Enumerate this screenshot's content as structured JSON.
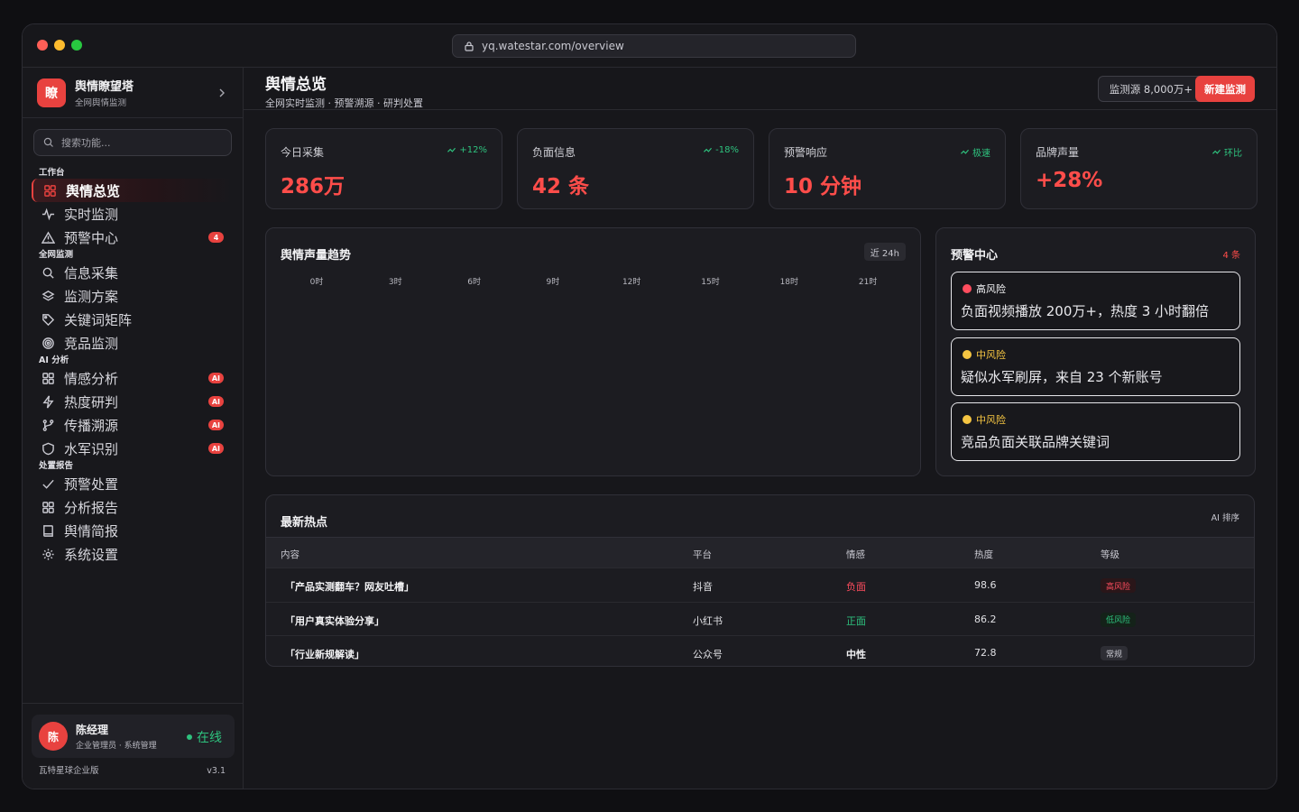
{
  "browser": {
    "url": "yq.watestar.com/overview"
  },
  "brand": {
    "logo_char": "瞭",
    "name": "舆情瞭望塔",
    "subtitle": "全网舆情监测"
  },
  "search": {
    "placeholder": "搜索功能..."
  },
  "sidebar": {
    "sections": [
      {
        "title": "工作台",
        "items": [
          {
            "label": "舆情总览",
            "icon": "grid-icon",
            "active": true
          },
          {
            "label": "实时监测",
            "icon": "pulse-icon"
          },
          {
            "label": "预警中心",
            "icon": "warning-icon",
            "badge": "4"
          }
        ]
      },
      {
        "title": "全网监测",
        "items": [
          {
            "label": "信息采集",
            "icon": "search-icon"
          },
          {
            "label": "监测方案",
            "icon": "layers-icon"
          },
          {
            "label": "关键词矩阵",
            "icon": "tag-icon"
          },
          {
            "label": "竞品监测",
            "icon": "target-icon"
          }
        ]
      },
      {
        "title": "AI 分析",
        "items": [
          {
            "label": "情感分析",
            "icon": "grid-icon",
            "badge": "AI"
          },
          {
            "label": "热度研判",
            "icon": "lightning-icon",
            "badge": "AI"
          },
          {
            "label": "传播溯源",
            "icon": "branch-icon",
            "badge": "AI"
          },
          {
            "label": "水军识别",
            "icon": "shield-icon",
            "badge": "AI"
          }
        ]
      },
      {
        "title": "处置报告",
        "items": [
          {
            "label": "预警处置",
            "icon": "check-icon"
          },
          {
            "label": "分析报告",
            "icon": "grid-icon"
          },
          {
            "label": "舆情简报",
            "icon": "book-icon"
          },
          {
            "label": "系统设置",
            "icon": "gear-icon"
          }
        ]
      }
    ]
  },
  "user": {
    "avatar": "陈",
    "name": "陈经理",
    "role": "企业管理员 · 系统管理",
    "status": "在线"
  },
  "footer": {
    "edition": "瓦特星球企业版",
    "version": "v3.1"
  },
  "header": {
    "title": "舆情总览",
    "subtitle": "全网实时监测 · 预警溯源 · 研判处置",
    "sources_label": "监测源 8,000万+",
    "new_label": "新建监测"
  },
  "stats": [
    {
      "label": "今日采集",
      "trend": "+12%",
      "value": "286万"
    },
    {
      "label": "负面信息",
      "trend": "-18%",
      "value": "42 条"
    },
    {
      "label": "预警响应",
      "trend": "极速",
      "value": "10 分钟"
    },
    {
      "label": "品牌声量",
      "trend": "环比",
      "value": "+28%"
    }
  ],
  "trend": {
    "title": "舆情声量趋势",
    "range": "近 24h",
    "ticks": [
      "0时",
      "3时",
      "6时",
      "9时",
      "12时",
      "15时",
      "18时",
      "21时"
    ]
  },
  "alerts": {
    "title": "预警中心",
    "count": "4 条",
    "items": [
      {
        "level": "高风险",
        "color": "#ff4d5e",
        "text": "负面视频播放 200万+，热度 3 小时翻倍"
      },
      {
        "level": "中风险",
        "color": "#f5c542",
        "text": "疑似水军刷屏，来自 23 个新账号"
      },
      {
        "level": "中风险",
        "color": "#f5c542",
        "text": "竞品负面关联品牌关键词"
      }
    ]
  },
  "hot": {
    "title": "最新热点",
    "sort": "AI 排序",
    "columns": [
      "内容",
      "平台",
      "情感",
      "热度",
      "等级"
    ],
    "rows": [
      {
        "content": "「产品实测翻车？网友吐槽」",
        "platform": "抖音",
        "sentiment": "负面",
        "sentiment_color": "#ff4d5e",
        "heat": "98.6",
        "level": "高风险",
        "level_color": "#ff4d5e",
        "level_bg": "#2a1619"
      },
      {
        "content": "「用户真实体验分享」",
        "platform": "小红书",
        "sentiment": "正面",
        "sentiment_color": "#2ec27e",
        "heat": "86.2",
        "level": "低风险",
        "level_color": "#2ec27e",
        "level_bg": "#142219"
      },
      {
        "content": "「行业新规解读」",
        "platform": "公众号",
        "sentiment": "中性",
        "sentiment_color": "#f2f2f4",
        "heat": "72.8",
        "level": "常规",
        "level_color": "#c8c8d0",
        "level_bg": "#2e2e35"
      }
    ]
  },
  "colors": {
    "accent": "#e8423f",
    "positive": "#2ec27e",
    "warning": "#f5c542"
  }
}
